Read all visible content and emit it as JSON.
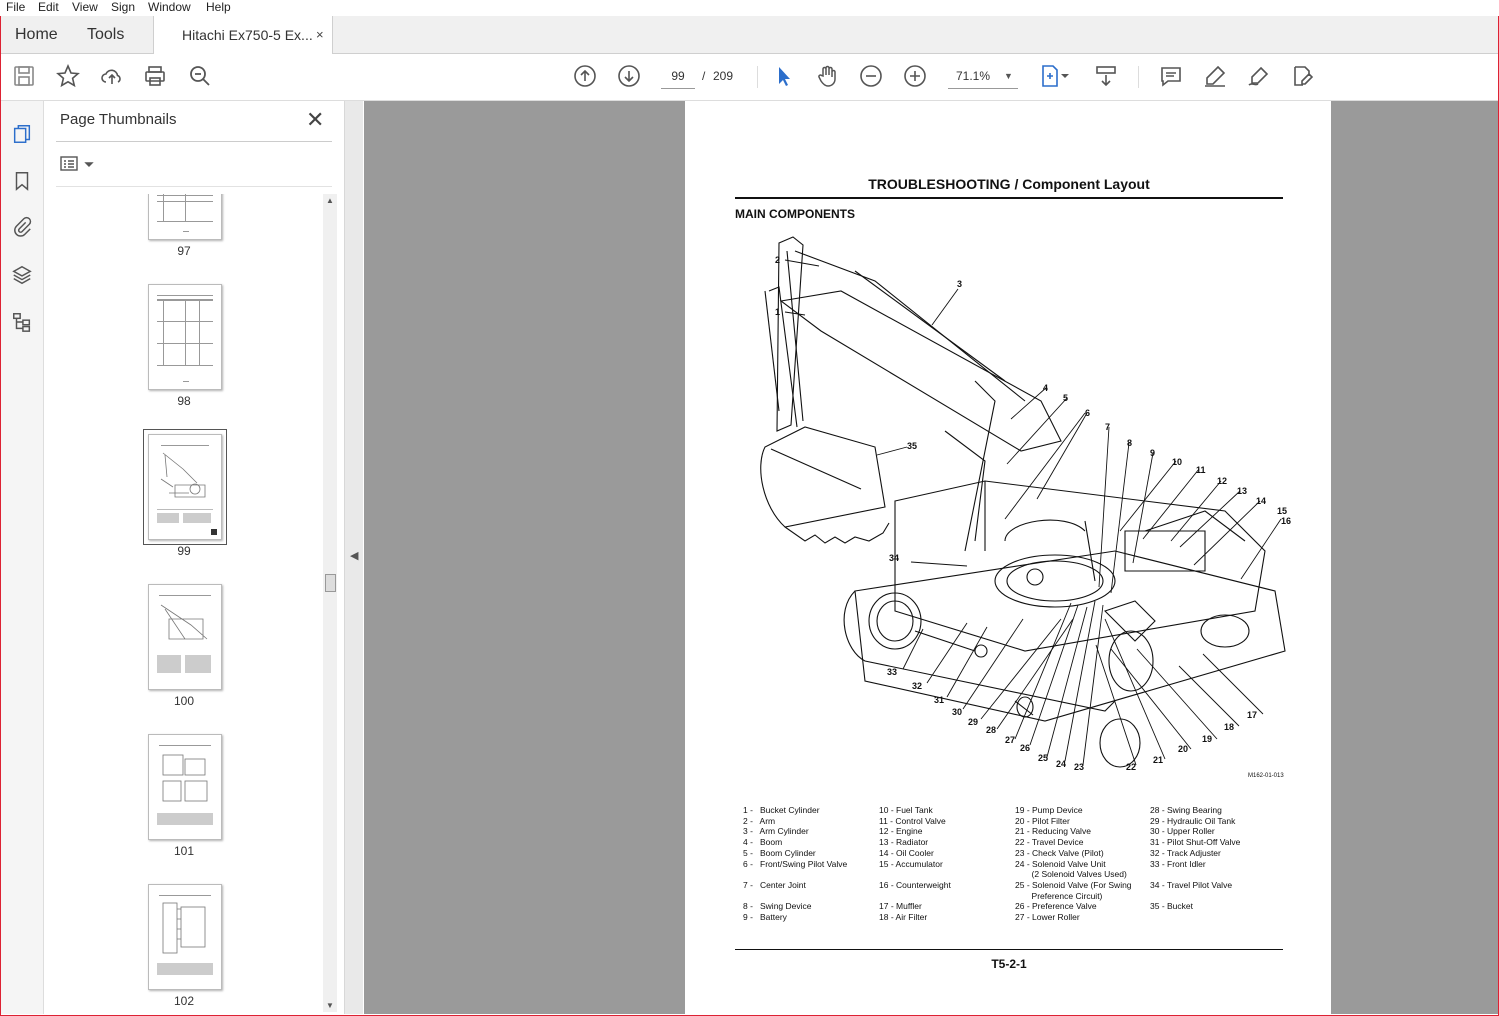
{
  "menu": [
    "File",
    "Edit",
    "View",
    "Sign",
    "Window",
    "Help"
  ],
  "tabs": {
    "home": "Home",
    "tools": "Tools",
    "document": "Hitachi Ex750-5 Ex...",
    "close": "×"
  },
  "toolbar": {
    "page_current": "99",
    "page_sep": "/",
    "page_total": "209",
    "zoom": "71.1%"
  },
  "panel": {
    "title": "Page Thumbnails",
    "close": "✕"
  },
  "thumbnails": [
    {
      "label": "97"
    },
    {
      "label": "98"
    },
    {
      "label": "99"
    },
    {
      "label": "100"
    },
    {
      "label": "101"
    },
    {
      "label": "102"
    }
  ],
  "page": {
    "title": "TROUBLESHOOTING / Component Layout",
    "subtitle": "MAIN COMPONENTS",
    "figure_code": "M162-01-013",
    "footer": "T5-2-1",
    "callouts": [
      "1",
      "2",
      "3",
      "4",
      "5",
      "6",
      "7",
      "8",
      "9",
      "10",
      "11",
      "12",
      "13",
      "14",
      "15",
      "16",
      "17",
      "18",
      "19",
      "20",
      "21",
      "22",
      "23",
      "24",
      "25",
      "26",
      "27",
      "28",
      "29",
      "30",
      "31",
      "32",
      "33",
      "34",
      "35"
    ],
    "legend": [
      [
        "1 -   Bucket Cylinder",
        "2 -   Arm",
        "3 -   Arm Cylinder",
        "4 -   Boom",
        "5 -   Boom Cylinder",
        "6 -   Front/Swing Pilot Valve",
        "",
        "7 -   Center Joint",
        "",
        "8 -   Swing Device",
        "9 -   Battery"
      ],
      [
        "10 - Fuel Tank",
        "11 - Control Valve",
        "12 - Engine",
        "13 - Radiator",
        "14 - Oil Cooler",
        "15 - Accumulator",
        "",
        "16 - Counterweight",
        "",
        "17 - Muffler",
        "18 - Air Filter"
      ],
      [
        "19 - Pump Device",
        "20 - Pilot Filter",
        "21 - Reducing Valve",
        "22 - Travel Device",
        "23 - Check Valve (Pilot)",
        "24 - Solenoid Valve Unit",
        "       (2 Solenoid Valves Used)",
        "25 - Solenoid Valve (For Swing",
        "       Preference Circuit)",
        "26 - Preference Valve",
        "27 - Lower Roller"
      ],
      [
        "28 - Swing Bearing",
        "29 - Hydraulic Oil Tank",
        "30 - Upper Roller",
        "31 - Pilot Shut-Off Valve",
        "32 - Track Adjuster",
        "33 - Front Idler",
        "",
        "34 - Travel Pilot Valve",
        "",
        "35 - Bucket",
        ""
      ]
    ]
  }
}
